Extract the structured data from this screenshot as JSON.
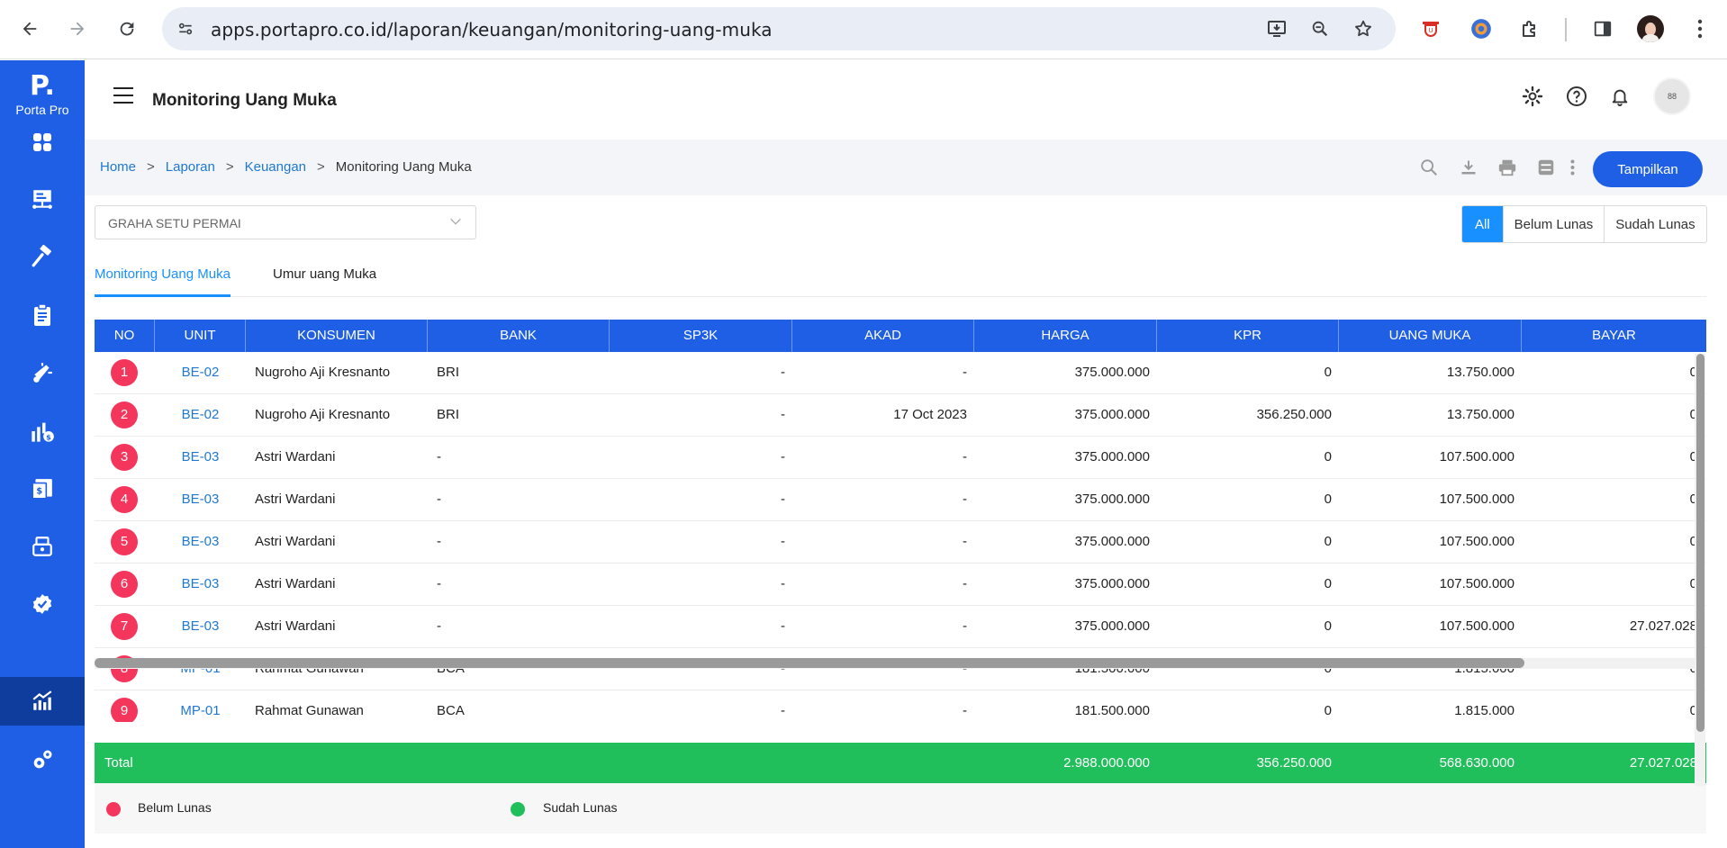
{
  "browser": {
    "url": "apps.portapro.co.id/laporan/keuangan/monitoring-uang-muka"
  },
  "sidebar": {
    "logo_mark": "P.",
    "logo_text": "Porta Pro",
    "items": [
      {
        "icon": "dashboard-icon"
      },
      {
        "icon": "project-board-icon"
      },
      {
        "icon": "construction-hammer-icon"
      },
      {
        "icon": "clipboard-icon"
      },
      {
        "icon": "marketing-megaphone-icon"
      },
      {
        "icon": "finance-chart-icon"
      },
      {
        "icon": "invoice-icon"
      },
      {
        "icon": "cash-register-icon"
      },
      {
        "icon": "verified-badge-icon"
      },
      {
        "icon": "report-chart-icon",
        "active": true
      },
      {
        "icon": "settings-cogs-icon"
      }
    ]
  },
  "header": {
    "title": "Monitoring Uang Muka",
    "avatar_text": "88"
  },
  "breadcrumb": {
    "home": "Home",
    "laporan": "Laporan",
    "keuangan": "Keuangan",
    "current": "Monitoring Uang Muka",
    "separator": ">"
  },
  "toolbar": {
    "show_button": "Tampilkan"
  },
  "filters": {
    "project": "GRAHA SETU PERMAI",
    "status_options": [
      "All",
      "Belum Lunas",
      "Sudah Lunas"
    ],
    "status_selected": "All"
  },
  "tabs": [
    "Monitoring Uang Muka",
    "Umur uang Muka"
  ],
  "table": {
    "columns": [
      "NO",
      "UNIT",
      "KONSUMEN",
      "BANK",
      "SP3K",
      "AKAD",
      "HARGA",
      "KPR",
      "UANG MUKA",
      "BAYAR"
    ],
    "rows": [
      {
        "no": "1",
        "unit": "BE-02",
        "konsumen": "Nugroho Aji Kresnanto",
        "bank": "BRI",
        "sp3k": "-",
        "akad": "-",
        "harga": "375.000.000",
        "kpr": "0",
        "uang_muka": "13.750.000",
        "bayar": "0"
      },
      {
        "no": "2",
        "unit": "BE-02",
        "konsumen": "Nugroho Aji Kresnanto",
        "bank": "BRI",
        "sp3k": "-",
        "akad": "17 Oct 2023",
        "harga": "375.000.000",
        "kpr": "356.250.000",
        "uang_muka": "13.750.000",
        "bayar": "0"
      },
      {
        "no": "3",
        "unit": "BE-03",
        "konsumen": "Astri Wardani",
        "bank": "-",
        "sp3k": "-",
        "akad": "-",
        "harga": "375.000.000",
        "kpr": "0",
        "uang_muka": "107.500.000",
        "bayar": "0"
      },
      {
        "no": "4",
        "unit": "BE-03",
        "konsumen": "Astri Wardani",
        "bank": "-",
        "sp3k": "-",
        "akad": "-",
        "harga": "375.000.000",
        "kpr": "0",
        "uang_muka": "107.500.000",
        "bayar": "0"
      },
      {
        "no": "5",
        "unit": "BE-03",
        "konsumen": "Astri Wardani",
        "bank": "-",
        "sp3k": "-",
        "akad": "-",
        "harga": "375.000.000",
        "kpr": "0",
        "uang_muka": "107.500.000",
        "bayar": "0"
      },
      {
        "no": "6",
        "unit": "BE-03",
        "konsumen": "Astri Wardani",
        "bank": "-",
        "sp3k": "-",
        "akad": "-",
        "harga": "375.000.000",
        "kpr": "0",
        "uang_muka": "107.500.000",
        "bayar": "0"
      },
      {
        "no": "7",
        "unit": "BE-03",
        "konsumen": "Astri Wardani",
        "bank": "-",
        "sp3k": "-",
        "akad": "-",
        "harga": "375.000.000",
        "kpr": "0",
        "uang_muka": "107.500.000",
        "bayar": "27.027.028"
      },
      {
        "no": "8",
        "unit": "MP-01",
        "konsumen": "Rahmat Gunawan",
        "bank": "BCA",
        "sp3k": "-",
        "akad": "-",
        "harga": "181.500.000",
        "kpr": "0",
        "uang_muka": "1.815.000",
        "bayar": "0"
      },
      {
        "no": "9",
        "unit": "MP-01",
        "konsumen": "Rahmat Gunawan",
        "bank": "BCA",
        "sp3k": "-",
        "akad": "-",
        "harga": "181.500.000",
        "kpr": "0",
        "uang_muka": "1.815.000",
        "bayar": "0"
      }
    ],
    "total": {
      "label": "Total",
      "harga": "2.988.000.000",
      "kpr": "356.250.000",
      "uang_muka": "568.630.000",
      "bayar": "27.027.028"
    }
  },
  "legend": {
    "belum_lunas": "Belum Lunas",
    "sudah_lunas": "Sudah Lunas"
  },
  "colors": {
    "primary": "#1e5fe6",
    "total_row": "#21bf5b",
    "belum_lunas": "#f5365c",
    "sudah_lunas": "#21bf5b",
    "link": "#1f78d1"
  }
}
